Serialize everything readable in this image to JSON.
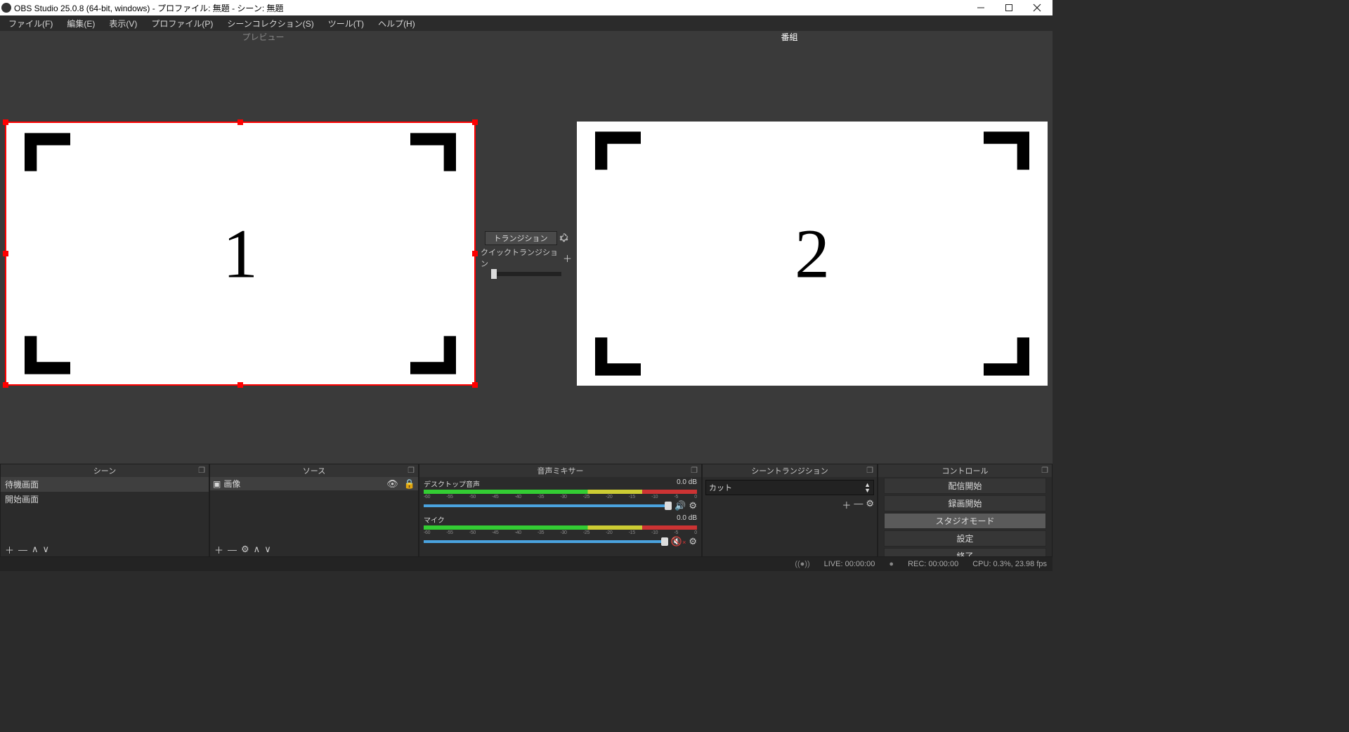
{
  "window": {
    "title": "OBS Studio 25.0.8 (64-bit, windows) - プロファイル: 無題 - シーン: 無題"
  },
  "menubar": [
    "ファイル(F)",
    "編集(E)",
    "表示(V)",
    "プロファイル(P)",
    "シーンコレクション(S)",
    "ツール(T)",
    "ヘルプ(H)"
  ],
  "split": {
    "preview": "プレビュー",
    "program": "番組"
  },
  "transition": {
    "button": "トランジション",
    "quick": "クイックトランジション"
  },
  "canvas": {
    "left_num": "1",
    "right_num": "2"
  },
  "docks": {
    "scenes": {
      "title": "シーン",
      "items": [
        "待機画面",
        "開始画面"
      ]
    },
    "sources": {
      "title": "ソース",
      "items": [
        {
          "name": "画像"
        }
      ]
    },
    "mixer": {
      "title": "音声ミキサー",
      "tracks": [
        {
          "name": "デスクトップ音声",
          "db": "0.0 dB",
          "muted": false
        },
        {
          "name": "マイク",
          "db": "0.0 dB",
          "muted": true
        }
      ],
      "scale_ticks": [
        "-60",
        "-55",
        "-50",
        "-45",
        "-40",
        "-35",
        "-30",
        "-25",
        "-20",
        "-15",
        "-10",
        "-5",
        "0"
      ]
    },
    "sctrans": {
      "title": "シーントランジション",
      "selected": "カット"
    },
    "controls": {
      "title": "コントロール",
      "buttons": [
        "配信開始",
        "録画開始",
        "スタジオモード",
        "設定",
        "終了"
      ],
      "active_index": 2
    }
  },
  "status": {
    "live": "LIVE: 00:00:00",
    "rec": "REC: 00:00:00",
    "cpu": "CPU: 0.3%, 23.98 fps"
  }
}
